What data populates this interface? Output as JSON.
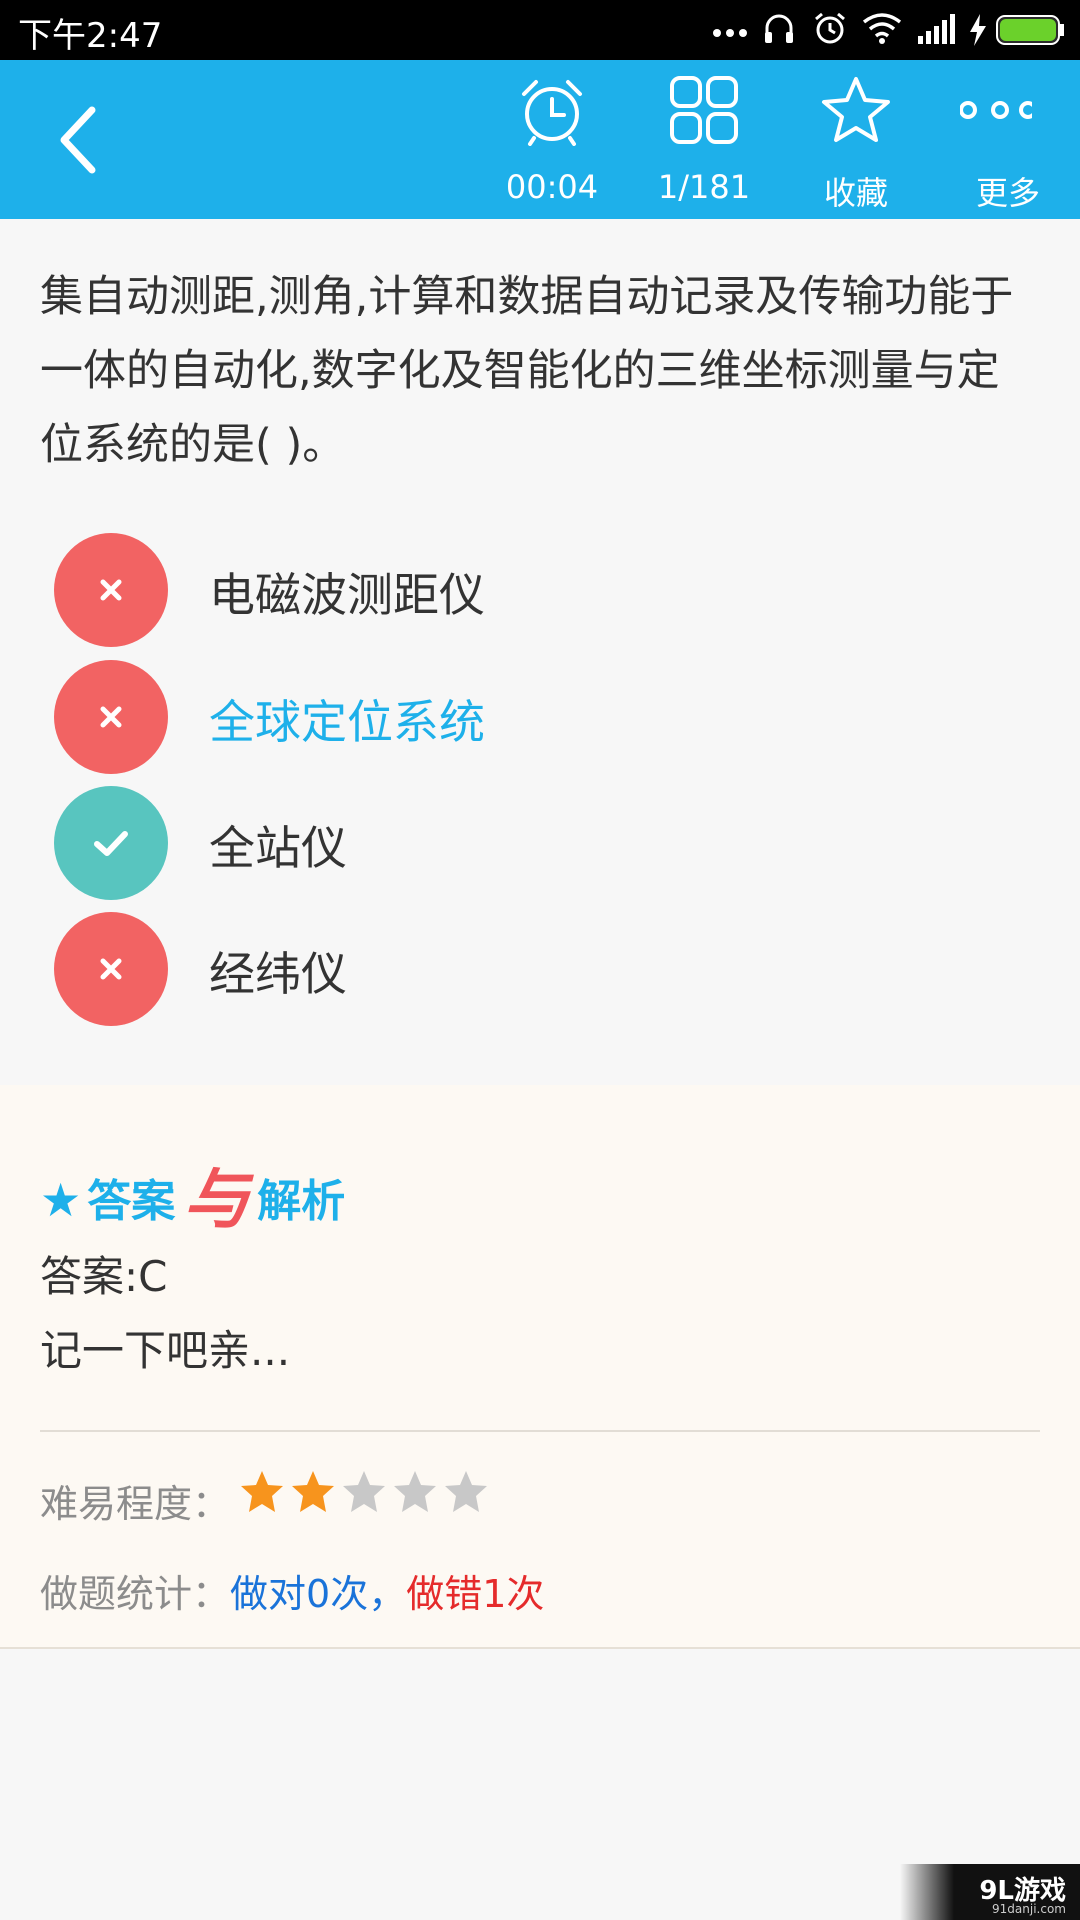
{
  "status_bar": {
    "time": "下午2:47"
  },
  "toolbar": {
    "timer": "00:04",
    "progress": "1/181",
    "favorite_label": "收藏",
    "more_label": "更多",
    "background_color": "#1eb0ea"
  },
  "question": {
    "text": "集自动测距,测角,计算和数据自动记录及传输功能于一体的自动化,数字化及智能化的三维坐标测量与定位系统的是(   )。"
  },
  "options": [
    {
      "text": "电磁波测距仪",
      "status": "wrong",
      "icon": "cross-icon"
    },
    {
      "text": "全球定位系统",
      "status": "wrong",
      "selected": true,
      "icon": "cross-icon"
    },
    {
      "text": "全站仪",
      "status": "correct",
      "icon": "check-icon"
    },
    {
      "text": "经纬仪",
      "status": "wrong",
      "icon": "cross-icon"
    }
  ],
  "analysis": {
    "title_part1": "答案",
    "title_amp": "与",
    "title_part2": "解析",
    "answer": "答案:C",
    "explanation": "记一下吧亲...",
    "difficulty_label": "难易程度：",
    "difficulty_value": 2,
    "difficulty_max": 5,
    "stats_label": "做题统计：",
    "stats_right": "做对0次",
    "stats_separator": "，",
    "stats_wrong": "做错1次"
  },
  "colors": {
    "wrong": "#f26363",
    "correct": "#58c5bf",
    "accent": "#1eb0ea",
    "star_on": "#f7941d",
    "star_off": "#c8c8c8"
  },
  "watermark": {
    "main": "9L游戏",
    "sub": "91danji.com"
  }
}
